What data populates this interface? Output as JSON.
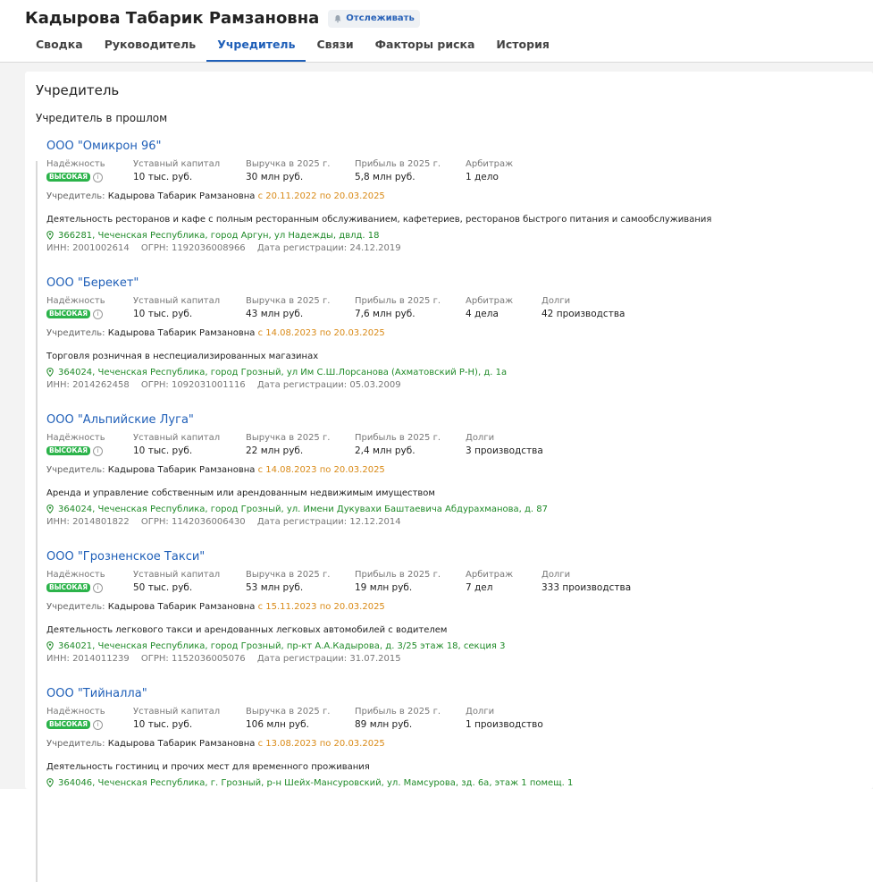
{
  "header": {
    "title": "Кадырова Табарик Рамзановна",
    "follow_label": "Отслеживать",
    "tabs": [
      "Сводка",
      "Руководитель",
      "Учредитель",
      "Связи",
      "Факторы риска",
      "История"
    ],
    "active_tab": "Учредитель"
  },
  "section": {
    "title": "Учредитель",
    "subtitle": "Учредитель в прошлом"
  },
  "labels": {
    "reliability": "Надёжность",
    "capital": "Уставный капитал",
    "revenue": "Выручка в 2025 г.",
    "profit": "Прибыль в 2025 г.",
    "arbitration": "Арбитраж",
    "debts": "Долги",
    "badge": "ВЫСОКАЯ",
    "founder_prefix": "Учредитель:"
  },
  "colors": {
    "link": "#1f5fb8",
    "badge": "#2bb34a",
    "period": "#d98a17",
    "address": "#1f8a28"
  },
  "companies": [
    {
      "name": "ООО \"Омикрон 96\"",
      "capital": "10 тыс. руб.",
      "revenue": "30 млн руб.",
      "profit": "5,8 млн руб.",
      "extra1_label": "Арбитраж",
      "extra1_value": "1 дело",
      "extra2_label": "",
      "extra2_value": "",
      "founder_name": "Кадырова Табарик Рамзановна",
      "founder_period": "с 20.11.2022 по 20.03.2025",
      "activity": "Деятельность ресторанов и кафе с полным ресторанным обслуживанием, кафетериев, ресторанов быстрого питания и самообслуживания",
      "address": "366281, Чеченская Республика, город Аргун, ул Надежды, двлд. 18",
      "inn": "ИНН: 2001002614",
      "ogrn": "ОГРН: 1192036008966",
      "reg_date": "Дата регистрации: 24.12.2019"
    },
    {
      "name": "ООО \"Берекет\"",
      "capital": "10 тыс. руб.",
      "revenue": "43 млн руб.",
      "profit": "7,6 млн руб.",
      "extra1_label": "Арбитраж",
      "extra1_value": "4 дела",
      "extra2_label": "Долги",
      "extra2_value": "42 производства",
      "founder_name": "Кадырова Табарик Рамзановна",
      "founder_period": "с 14.08.2023 по 20.03.2025",
      "activity": "Торговля розничная в неспециализированных магазинах",
      "address": "364024, Чеченская Республика, город Грозный, ул Им С.Ш.Лорсанова (Ахматовский Р-Н), д. 1а",
      "inn": "ИНН: 2014262458",
      "ogrn": "ОГРН: 1092031001116",
      "reg_date": "Дата регистрации: 05.03.2009"
    },
    {
      "name": "ООО \"Альпийские Луга\"",
      "capital": "10 тыс. руб.",
      "revenue": "22 млн руб.",
      "profit": "2,4 млн руб.",
      "extra1_label": "Долги",
      "extra1_value": "3 производства",
      "extra2_label": "",
      "extra2_value": "",
      "founder_name": "Кадырова Табарик Рамзановна",
      "founder_period": "с 14.08.2023 по 20.03.2025",
      "activity": "Аренда и управление собственным или арендованным недвижимым имуществом",
      "address": "364024, Чеченская Республика, город Грозный, ул. Имени Дукувахи Баштаевича Абдурахманова, д. 87",
      "inn": "ИНН: 2014801822",
      "ogrn": "ОГРН: 1142036006430",
      "reg_date": "Дата регистрации: 12.12.2014"
    },
    {
      "name": "ООО \"Грозненское Такси\"",
      "capital": "50 тыс. руб.",
      "revenue": "53 млн руб.",
      "profit": "19 млн руб.",
      "extra1_label": "Арбитраж",
      "extra1_value": "7 дел",
      "extra2_label": "Долги",
      "extra2_value": "333 производства",
      "founder_name": "Кадырова Табарик Рамзановна",
      "founder_period": "с 15.11.2023 по 20.03.2025",
      "activity": "Деятельность легкового такси и арендованных легковых автомобилей с водителем",
      "address": "364021, Чеченская Республика, город Грозный, пр-кт А.А.Кадырова, д. 3/25 этаж 18, секция 3",
      "inn": "ИНН: 2014011239",
      "ogrn": "ОГРН: 1152036005076",
      "reg_date": "Дата регистрации: 31.07.2015"
    },
    {
      "name": "ООО \"Тийналла\"",
      "capital": "10 тыс. руб.",
      "revenue": "106 млн руб.",
      "profit": "89 млн руб.",
      "extra1_label": "Долги",
      "extra1_value": "1 производство",
      "extra2_label": "",
      "extra2_value": "",
      "founder_name": "Кадырова Табарик Рамзановна",
      "founder_period": "с 13.08.2023 по 20.03.2025",
      "activity": "Деятельность гостиниц и прочих мест для временного проживания",
      "address": "364046, Чеченская Республика, г. Грозный, р-н Шейх-Мансуровский, ул. Мамсурова, зд. 6а, этаж 1 помещ. 1",
      "inn": "",
      "ogrn": "",
      "reg_date": ""
    }
  ]
}
